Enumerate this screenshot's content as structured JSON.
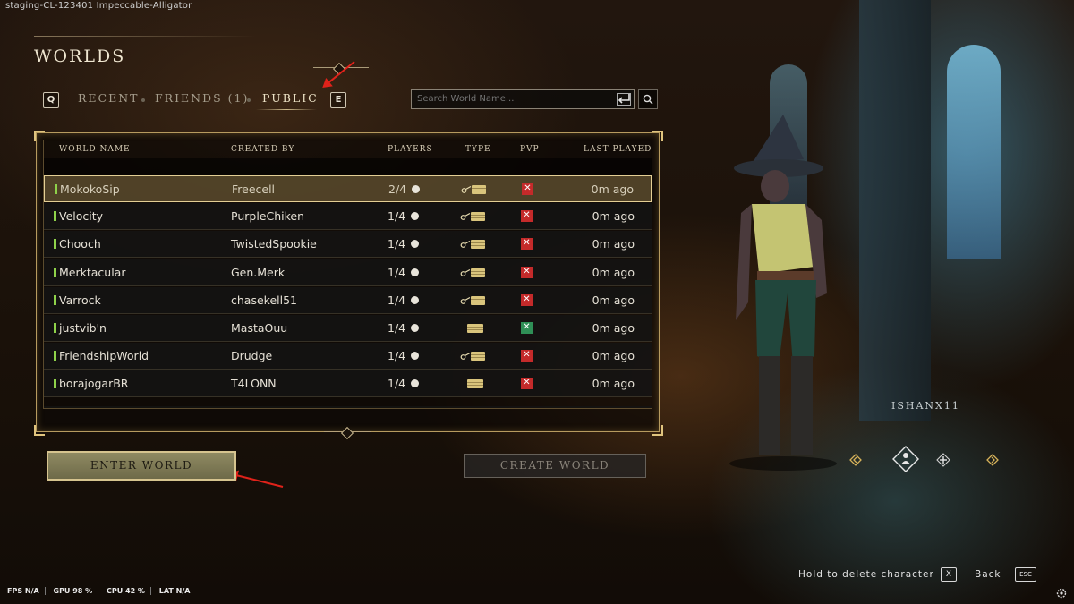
{
  "build_tag": "staging-CL-123401 Impeccable-Alligator",
  "title": "WORLDS",
  "tabs": {
    "prev_key": "Q",
    "next_key": "E",
    "items": [
      {
        "label": "RECENT",
        "active": false
      },
      {
        "label": "FRIENDS (1)",
        "active": false
      },
      {
        "label": "PUBLIC",
        "active": true
      }
    ]
  },
  "search": {
    "placeholder": "Search World Name..."
  },
  "table": {
    "headers": {
      "world_name": "WORLD NAME",
      "created_by": "CREATED BY",
      "players": "PLAYERS",
      "type": "TYPE",
      "pvp": "PVP",
      "last_played": "LAST PLAYED"
    },
    "rows": [
      {
        "name": "MokokoSip",
        "creator": "Freecell",
        "players": "2/4",
        "type": "key-chest",
        "pvp": false,
        "last_played": "0m ago",
        "selected": true
      },
      {
        "name": "Velocity",
        "creator": "PurpleChiken",
        "players": "1/4",
        "type": "key-chest",
        "pvp": false,
        "last_played": "0m ago",
        "selected": false
      },
      {
        "name": "Chooch",
        "creator": "TwistedSpookie",
        "players": "1/4",
        "type": "key-chest",
        "pvp": false,
        "last_played": "0m ago",
        "selected": false
      },
      {
        "name": "Merktacular",
        "creator": "Gen.Merk",
        "players": "1/4",
        "type": "key-chest",
        "pvp": false,
        "last_played": "0m ago",
        "selected": false
      },
      {
        "name": "Varrock",
        "creator": "chasekell51",
        "players": "1/4",
        "type": "key-chest",
        "pvp": false,
        "last_played": "0m ago",
        "selected": false
      },
      {
        "name": "justvib'n",
        "creator": "MastaOuu",
        "players": "1/4",
        "type": "chest",
        "pvp": true,
        "last_played": "0m ago",
        "selected": false
      },
      {
        "name": "FriendshipWorld",
        "creator": "Drudge",
        "players": "1/4",
        "type": "key-chest",
        "pvp": false,
        "last_played": "0m ago",
        "selected": false
      },
      {
        "name": "borajogarBR",
        "creator": "T4LONN",
        "players": "1/4",
        "type": "chest",
        "pvp": false,
        "last_played": "0m ago",
        "selected": false
      }
    ]
  },
  "buttons": {
    "enter_world": "ENTER WORLD",
    "create_world": "CREATE WORLD"
  },
  "character": {
    "name": "ISHANX11"
  },
  "hints": {
    "delete_label": "Hold to delete character",
    "delete_key": "X",
    "back_label": "Back",
    "back_key": "ESC"
  },
  "stats": {
    "fps_label": "FPS",
    "fps_value": "N/A",
    "gpu_label": "GPU",
    "gpu_value": "98 %",
    "cpu_label": "CPU",
    "cpu_value": "42 %",
    "lat_label": "LAT",
    "lat_value": "N/A"
  },
  "colors": {
    "accent_gold": "#d6c48f",
    "pvp_off": "#c42a2a",
    "pvp_on": "#2f8f56",
    "online": "#8fd24a",
    "annotation_arrow": "#e0221a"
  }
}
